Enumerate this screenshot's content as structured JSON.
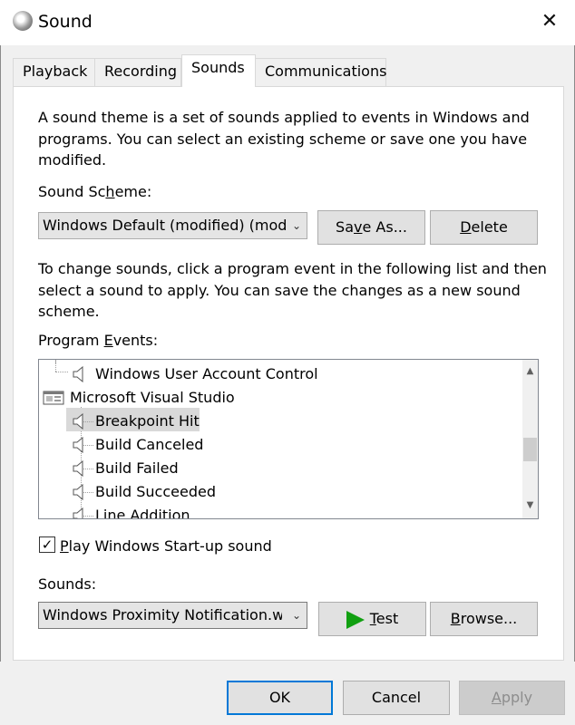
{
  "window": {
    "title": "Sound",
    "close_icon": "close-icon"
  },
  "tabs": [
    {
      "label": "Playback",
      "active": false
    },
    {
      "label": "Recording",
      "active": false
    },
    {
      "label": "Sounds",
      "active": true
    },
    {
      "label": "Communications",
      "active": false
    }
  ],
  "description": {
    "line1": "A sound theme is a set of sounds applied to events in Windows and",
    "line2": "programs.  You can select an existing scheme or save one you have",
    "line3": "modified."
  },
  "scheme": {
    "label_pre": "Sound Sc",
    "label_key": "h",
    "label_post": "eme:",
    "value": "Windows Default (modified) (mod",
    "save_as_pre": "Sa",
    "save_as_key": "v",
    "save_as_post": "e As...",
    "delete_key": "D",
    "delete_post": "elete"
  },
  "instructions": {
    "line1": "To change sounds, click a program event in the following list and then",
    "line2": "select a sound to apply.  You can save the changes as a new sound",
    "line3": "scheme."
  },
  "events": {
    "label_pre": "Program ",
    "label_key": "E",
    "label_post": "vents:",
    "items": [
      {
        "label": "Windows User Account Control",
        "type": "event"
      },
      {
        "label": "Microsoft Visual Studio",
        "type": "group"
      },
      {
        "label": "Breakpoint Hit",
        "type": "event",
        "selected": true
      },
      {
        "label": "Build Canceled",
        "type": "event"
      },
      {
        "label": "Build Failed",
        "type": "event"
      },
      {
        "label": "Build Succeeded",
        "type": "event"
      },
      {
        "label": "Line Addition",
        "type": "event"
      }
    ]
  },
  "startup": {
    "checked": true,
    "label_key": "P",
    "label_post": "lay Windows Start-up sound"
  },
  "sounds": {
    "label": "Sounds:",
    "value": "Windows Proximity Notification.wa",
    "test_key": "T",
    "test_post": "est",
    "browse_key": "B",
    "browse_post": "rowse..."
  },
  "footer": {
    "ok": "OK",
    "cancel": "Cancel",
    "apply_key": "A",
    "apply_post": "pply",
    "apply_enabled": false
  }
}
